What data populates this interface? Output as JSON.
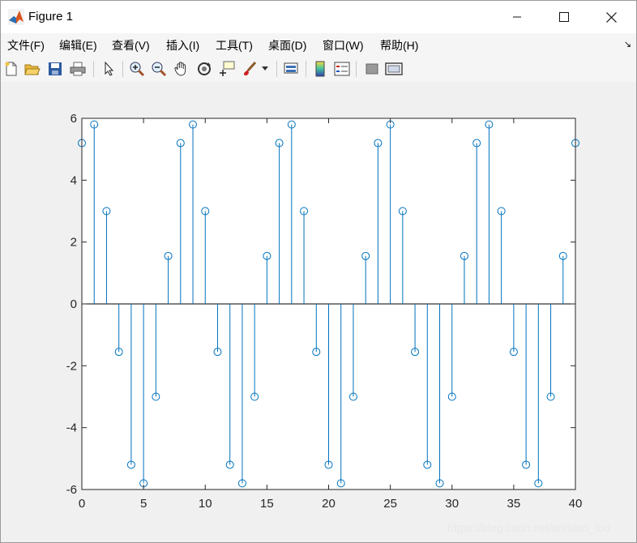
{
  "window": {
    "title": "Figure 1"
  },
  "menu": [
    "文件(F)",
    "编辑(E)",
    "查看(V)",
    "插入(I)",
    "工具(T)",
    "桌面(D)",
    "窗口(W)",
    "帮助(H)"
  ],
  "toolbar": [
    {
      "icon": "new-figure-icon"
    },
    {
      "icon": "open-file-icon"
    },
    {
      "icon": "save-icon"
    },
    {
      "icon": "print-icon"
    },
    {
      "icon": "select-arrow-icon"
    },
    {
      "icon": "zoom-in-icon"
    },
    {
      "icon": "zoom-out-icon"
    },
    {
      "icon": "pan-hand-icon"
    },
    {
      "icon": "rotate-3d-icon"
    },
    {
      "icon": "data-cursor-icon"
    },
    {
      "icon": "brush-icon"
    },
    {
      "icon": "link-plot-icon"
    },
    {
      "icon": "colorbar-icon"
    },
    {
      "icon": "legend-icon"
    },
    {
      "icon": "hide-plot-tools-icon"
    },
    {
      "icon": "show-plot-tools-icon"
    }
  ],
  "watermark": "https://blog.csdn.net/aniston_luo",
  "colors": {
    "series": "#0072bd",
    "axes": "#262626",
    "background": "#ffffff"
  },
  "chart_data": {
    "type": "stem",
    "title": "",
    "xlabel": "",
    "ylabel": "",
    "xlim": [
      0,
      40
    ],
    "ylim": [
      -6,
      6
    ],
    "xticks": [
      0,
      5,
      10,
      15,
      20,
      25,
      30,
      35,
      40
    ],
    "yticks": [
      -6,
      -4,
      -2,
      0,
      2,
      4,
      6
    ],
    "grid": false,
    "marker": "circle",
    "x": [
      0,
      1,
      2,
      3,
      4,
      5,
      6,
      7,
      8,
      9,
      10,
      11,
      12,
      13,
      14,
      15,
      16,
      17,
      18,
      19,
      20,
      21,
      22,
      23,
      24,
      25,
      26,
      27,
      28,
      29,
      30,
      31,
      32,
      33,
      34,
      35,
      36,
      37,
      38,
      39,
      40
    ],
    "y": [
      5.2,
      5.8,
      3.0,
      -1.55,
      -5.2,
      -5.8,
      -3.0,
      1.55,
      5.2,
      5.8,
      3.0,
      -1.55,
      -5.2,
      -5.8,
      -3.0,
      1.55,
      5.2,
      5.8,
      3.0,
      -1.55,
      -5.2,
      -5.8,
      -3.0,
      1.55,
      5.2,
      5.8,
      3.0,
      -1.55,
      -5.2,
      -5.8,
      -3.0,
      1.55,
      5.2,
      5.8,
      3.0,
      -1.55,
      -5.2,
      -5.8,
      -3.0,
      1.55,
      5.2
    ]
  }
}
